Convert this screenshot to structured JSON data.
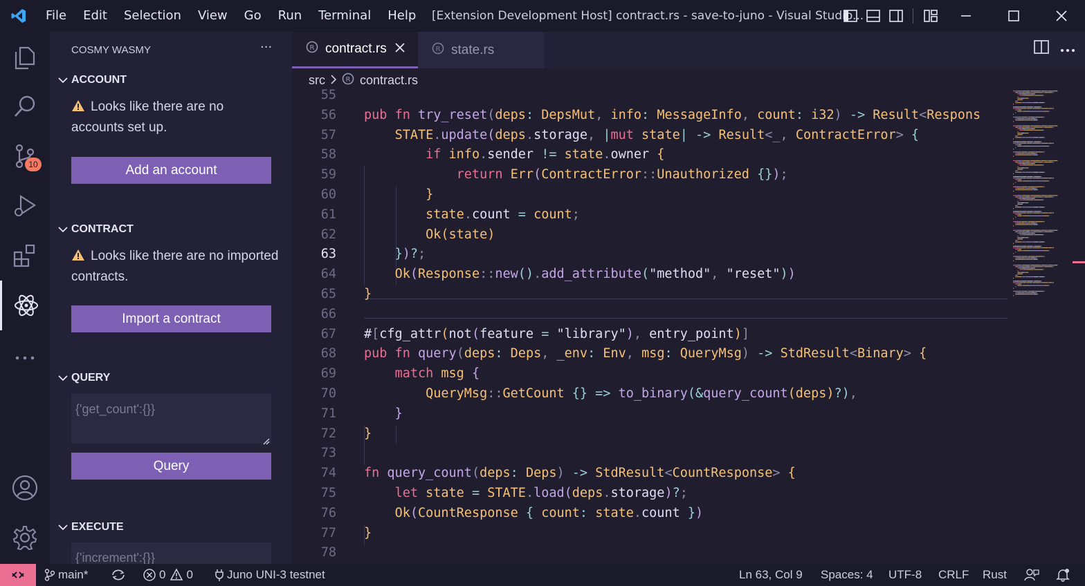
{
  "window": {
    "menu": [
      "File",
      "Edit",
      "Selection",
      "View",
      "Go",
      "Run",
      "Terminal",
      "Help"
    ],
    "title": "[Extension Development Host] contract.rs - save-to-juno - Visual Studio..."
  },
  "activity_bar": {
    "items": [
      "explorer-icon",
      "search-icon",
      "source-control-icon",
      "run-debug-icon",
      "extensions-icon",
      "cosmy-wasmy-icon",
      "more-icon",
      "account-icon",
      "settings-gear-icon"
    ],
    "source_control_badge": "10"
  },
  "sidebar": {
    "title": "COSMY WASMY",
    "sections": {
      "account": {
        "header": "ACCOUNT",
        "notice": "Looks like there are no accounts set up.",
        "button": "Add an account"
      },
      "contract": {
        "header": "CONTRACT",
        "notice": "Looks like there are no imported contracts.",
        "button": "Import a contract"
      },
      "query": {
        "header": "QUERY",
        "placeholder": "{'get_count':{}}",
        "button": "Query"
      },
      "execute": {
        "header": "EXECUTE",
        "placeholder": "{'increment':{}}"
      }
    }
  },
  "editor": {
    "tabs": [
      {
        "label": "contract.rs",
        "active": true
      },
      {
        "label": "state.rs",
        "active": false
      }
    ],
    "breadcrumb": [
      "src",
      "contract.rs"
    ],
    "current_line": 63,
    "lines": [
      {
        "n": 55,
        "tokens": []
      },
      {
        "n": 56,
        "tokens": [
          [
            "kw",
            "pub "
          ],
          [
            "kw",
            "fn "
          ],
          [
            "fn",
            "try_reset"
          ],
          [
            "pn",
            "("
          ],
          [
            "pm",
            "deps"
          ],
          [
            "op",
            ": "
          ],
          [
            "ty",
            "DepsMut"
          ],
          [
            "pn",
            ", "
          ],
          [
            "pm",
            "info"
          ],
          [
            "op",
            ": "
          ],
          [
            "ty",
            "MessageInfo"
          ],
          [
            "pn",
            ", "
          ],
          [
            "pm",
            "count"
          ],
          [
            "op",
            ": "
          ],
          [
            "ty",
            "i32"
          ],
          [
            "pn",
            ") "
          ],
          [
            "op",
            "-> "
          ],
          [
            "ty",
            "Result"
          ],
          [
            "pn",
            "<"
          ],
          [
            "ty",
            "Respons"
          ]
        ]
      },
      {
        "n": 57,
        "tokens": [
          [
            "co",
            "    "
          ],
          [
            "ty",
            "STATE"
          ],
          [
            "pn",
            "."
          ],
          [
            "fn",
            "update"
          ],
          [
            "pk",
            "("
          ],
          [
            "pm",
            "deps"
          ],
          [
            "pn",
            "."
          ],
          [
            "va",
            "storage"
          ],
          [
            "pn",
            ", "
          ],
          [
            "op",
            "|"
          ],
          [
            "kw",
            "mut "
          ],
          [
            "pm",
            "state"
          ],
          [
            "op",
            "| "
          ],
          [
            "op",
            "-> "
          ],
          [
            "ty",
            "Result"
          ],
          [
            "pn",
            "<_, "
          ],
          [
            "ty",
            "ContractError"
          ],
          [
            "pn",
            "> "
          ],
          [
            "pb",
            "{"
          ]
        ]
      },
      {
        "n": 58,
        "tokens": [
          [
            "co",
            "        "
          ],
          [
            "kw",
            "if "
          ],
          [
            "pm",
            "info"
          ],
          [
            "pn",
            "."
          ],
          [
            "va",
            "sender "
          ],
          [
            "op",
            "!= "
          ],
          [
            "pm",
            "state"
          ],
          [
            "pn",
            "."
          ],
          [
            "va",
            "owner "
          ],
          [
            "mc",
            "{"
          ]
        ]
      },
      {
        "n": 59,
        "tokens": [
          [
            "co",
            "            "
          ],
          [
            "kw",
            "return "
          ],
          [
            "ty",
            "Err"
          ],
          [
            "pk",
            "("
          ],
          [
            "ty",
            "ContractError"
          ],
          [
            "pn",
            "::"
          ],
          [
            "ty",
            "Unauthorized "
          ],
          [
            "pb",
            "{}"
          ],
          [
            "pk",
            ")"
          ],
          [
            "pn",
            ";"
          ]
        ]
      },
      {
        "n": 60,
        "tokens": [
          [
            "co",
            "        "
          ],
          [
            "mc",
            "}"
          ]
        ]
      },
      {
        "n": 61,
        "tokens": [
          [
            "co",
            "        "
          ],
          [
            "pm",
            "state"
          ],
          [
            "pn",
            "."
          ],
          [
            "va",
            "count "
          ],
          [
            "op",
            "= "
          ],
          [
            "pm",
            "count"
          ],
          [
            "pn",
            ";"
          ]
        ]
      },
      {
        "n": 62,
        "tokens": [
          [
            "co",
            "        "
          ],
          [
            "ty",
            "Ok"
          ],
          [
            "mc",
            "("
          ],
          [
            "pm",
            "state"
          ],
          [
            "mc",
            ")"
          ]
        ]
      },
      {
        "n": 63,
        "tokens": [
          [
            "co",
            "    "
          ],
          [
            "pb",
            "}"
          ],
          [
            "pk",
            ")"
          ],
          [
            "op",
            "?"
          ],
          [
            "pn",
            ";"
          ]
        ]
      },
      {
        "n": 64,
        "tokens": [
          [
            "co",
            "    "
          ],
          [
            "ty",
            "Ok"
          ],
          [
            "pk",
            "("
          ],
          [
            "ty",
            "Response"
          ],
          [
            "pn",
            "::"
          ],
          [
            "fn",
            "new"
          ],
          [
            "pb",
            "()"
          ],
          [
            "pn",
            "."
          ],
          [
            "fn",
            "add_attribute"
          ],
          [
            "pb",
            "("
          ],
          [
            "st",
            "\"method\""
          ],
          [
            "pn",
            ", "
          ],
          [
            "st",
            "\"reset\""
          ],
          [
            "pb",
            ")"
          ],
          [
            "pk",
            ")"
          ]
        ]
      },
      {
        "n": 65,
        "tokens": [
          [
            "mc",
            "}"
          ]
        ]
      },
      {
        "n": 66,
        "tokens": []
      },
      {
        "n": 67,
        "tokens": [
          [
            "va",
            "#"
          ],
          [
            "pn",
            "["
          ],
          [
            "va",
            "cfg_attr"
          ],
          [
            "mc",
            "("
          ],
          [
            "va",
            "not"
          ],
          [
            "pk",
            "("
          ],
          [
            "va",
            "feature "
          ],
          [
            "op",
            "= "
          ],
          [
            "st",
            "\"library\""
          ],
          [
            "pk",
            ")"
          ],
          [
            "pn",
            ", "
          ],
          [
            "va",
            "entry_point"
          ],
          [
            "mc",
            ")"
          ],
          [
            "pn",
            "]"
          ]
        ]
      },
      {
        "n": 68,
        "tokens": [
          [
            "kw",
            "pub "
          ],
          [
            "kw",
            "fn "
          ],
          [
            "fn",
            "query"
          ],
          [
            "pn",
            "("
          ],
          [
            "pm",
            "deps"
          ],
          [
            "op",
            ": "
          ],
          [
            "ty",
            "Deps"
          ],
          [
            "pn",
            ", "
          ],
          [
            "pm",
            "_env"
          ],
          [
            "op",
            ": "
          ],
          [
            "ty",
            "Env"
          ],
          [
            "pn",
            ", "
          ],
          [
            "pm",
            "msg"
          ],
          [
            "op",
            ": "
          ],
          [
            "ty",
            "QueryMsg"
          ],
          [
            "pn",
            ") "
          ],
          [
            "op",
            "-> "
          ],
          [
            "ty",
            "StdResult"
          ],
          [
            "pn",
            "<"
          ],
          [
            "ty",
            "Binary"
          ],
          [
            "pn",
            "> "
          ],
          [
            "mc",
            "{"
          ]
        ]
      },
      {
        "n": 69,
        "tokens": [
          [
            "co",
            "    "
          ],
          [
            "kw",
            "match "
          ],
          [
            "pm",
            "msg "
          ],
          [
            "pk",
            "{"
          ]
        ]
      },
      {
        "n": 70,
        "tokens": [
          [
            "co",
            "        "
          ],
          [
            "ty",
            "QueryMsg"
          ],
          [
            "pn",
            "::"
          ],
          [
            "ty",
            "GetCount "
          ],
          [
            "pb",
            "{} "
          ],
          [
            "op",
            "=> "
          ],
          [
            "fn",
            "to_binary"
          ],
          [
            "pb",
            "("
          ],
          [
            "op",
            "&"
          ],
          [
            "fn",
            "query_count"
          ],
          [
            "mc",
            "("
          ],
          [
            "pm",
            "deps"
          ],
          [
            "mc",
            ")"
          ],
          [
            "op",
            "?"
          ],
          [
            "pb",
            ")"
          ],
          [
            "pn",
            ","
          ]
        ]
      },
      {
        "n": 71,
        "tokens": [
          [
            "co",
            "    "
          ],
          [
            "pk",
            "}"
          ]
        ]
      },
      {
        "n": 72,
        "tokens": [
          [
            "mc",
            "}"
          ]
        ]
      },
      {
        "n": 73,
        "tokens": []
      },
      {
        "n": 74,
        "tokens": [
          [
            "kw",
            "fn "
          ],
          [
            "fn",
            "query_count"
          ],
          [
            "pn",
            "("
          ],
          [
            "pm",
            "deps"
          ],
          [
            "op",
            ": "
          ],
          [
            "ty",
            "Deps"
          ],
          [
            "pn",
            ") "
          ],
          [
            "op",
            "-> "
          ],
          [
            "ty",
            "StdResult"
          ],
          [
            "pn",
            "<"
          ],
          [
            "ty",
            "CountResponse"
          ],
          [
            "pn",
            "> "
          ],
          [
            "mc",
            "{"
          ]
        ]
      },
      {
        "n": 75,
        "tokens": [
          [
            "co",
            "    "
          ],
          [
            "kw",
            "let "
          ],
          [
            "pm",
            "state "
          ],
          [
            "op",
            "= "
          ],
          [
            "ty",
            "STATE"
          ],
          [
            "pn",
            "."
          ],
          [
            "fn",
            "load"
          ],
          [
            "pk",
            "("
          ],
          [
            "pm",
            "deps"
          ],
          [
            "pn",
            "."
          ],
          [
            "va",
            "storage"
          ],
          [
            "pk",
            ")"
          ],
          [
            "op",
            "?"
          ],
          [
            "pn",
            ";"
          ]
        ]
      },
      {
        "n": 76,
        "tokens": [
          [
            "co",
            "    "
          ],
          [
            "ty",
            "Ok"
          ],
          [
            "pk",
            "("
          ],
          [
            "ty",
            "CountResponse "
          ],
          [
            "pb",
            "{ "
          ],
          [
            "pm",
            "count"
          ],
          [
            "op",
            ": "
          ],
          [
            "pm",
            "state"
          ],
          [
            "pn",
            "."
          ],
          [
            "va",
            "count "
          ],
          [
            "pb",
            "}"
          ],
          [
            "pk",
            ")"
          ]
        ]
      },
      {
        "n": 77,
        "tokens": [
          [
            "mc",
            "}"
          ]
        ]
      },
      {
        "n": 78,
        "tokens": []
      }
    ]
  },
  "status_bar": {
    "branch": "main*",
    "errors": "0",
    "warnings": "0",
    "network": "Juno UNI-3 testnet",
    "cursor": "Ln 63, Col 9",
    "spaces": "Spaces: 4",
    "encoding": "UTF-8",
    "eol": "CRLF",
    "language": "Rust"
  },
  "colors": {
    "accent": "#7d5fb4",
    "remote": "#eb6f92",
    "warning": "#f6c177",
    "badge": "#f47a62"
  }
}
